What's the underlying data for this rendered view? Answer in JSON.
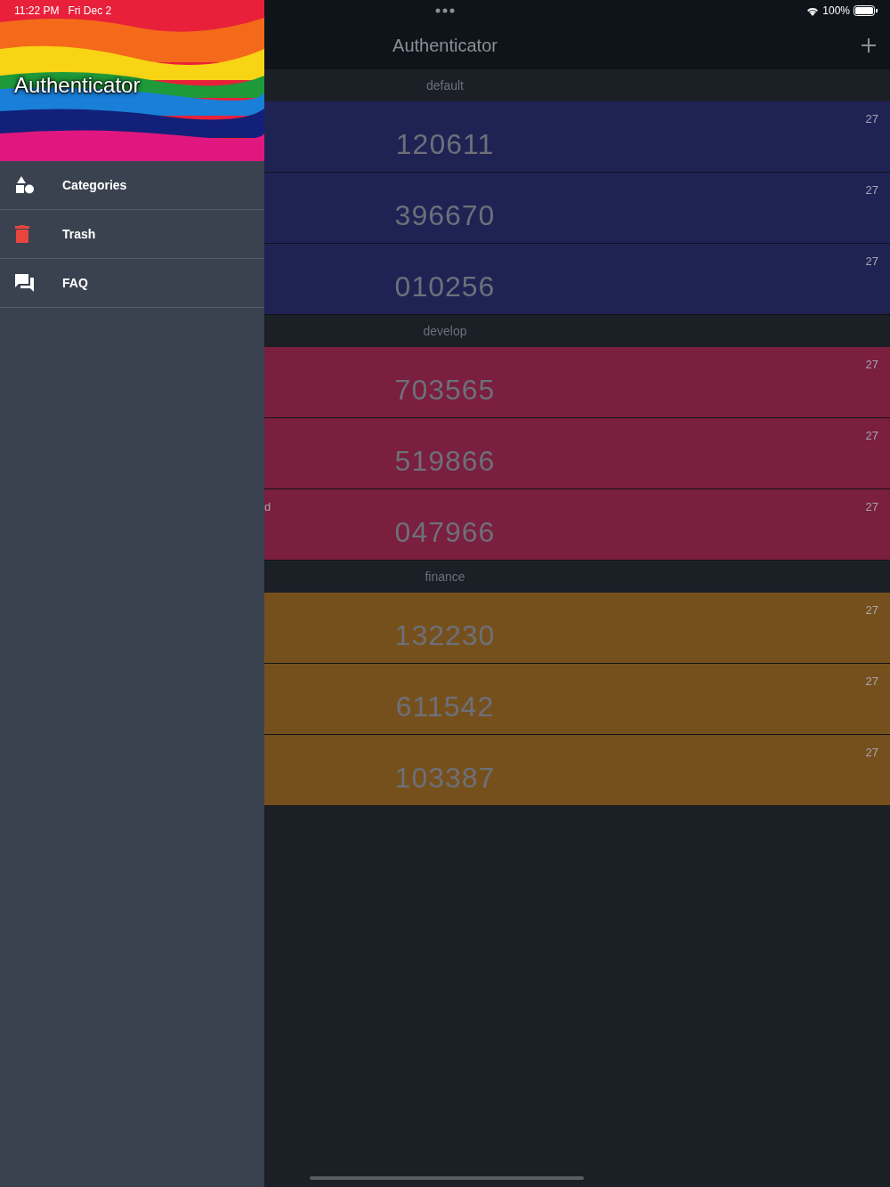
{
  "status_bar": {
    "time": "11:22 PM",
    "date": "Fri Dec 2",
    "battery": "100%"
  },
  "drawer": {
    "header": {
      "kind": "picture",
      "title": "Authenticator"
    },
    "items": [
      {
        "kind": "categories",
        "label": "Categories"
      },
      {
        "kind": "trash",
        "label": "Trash"
      },
      {
        "kind": "faq",
        "label": "FAQ"
      }
    ]
  },
  "nav_bar": {
    "title": "Authenticator"
  },
  "groups": [
    {
      "name": "default",
      "color": "#1f2354",
      "accounts": [
        {
          "code": "120611",
          "timer": "27"
        },
        {
          "code": "396670",
          "timer": "27"
        },
        {
          "code": "010256",
          "timer": "27"
        }
      ]
    },
    {
      "name": "develop",
      "color": "#7a1f3d",
      "accounts": [
        {
          "code": "703565",
          "timer": "27"
        },
        {
          "code": "519866",
          "timer": "27"
        },
        {
          "label": "d",
          "code": "047966",
          "timer": "27"
        }
      ]
    },
    {
      "name": "finance",
      "color": "#76501c",
      "accounts": [
        {
          "code": "132230",
          "timer": "27"
        },
        {
          "code": "611542",
          "timer": "27"
        },
        {
          "code": "103387",
          "timer": "27"
        }
      ]
    }
  ]
}
